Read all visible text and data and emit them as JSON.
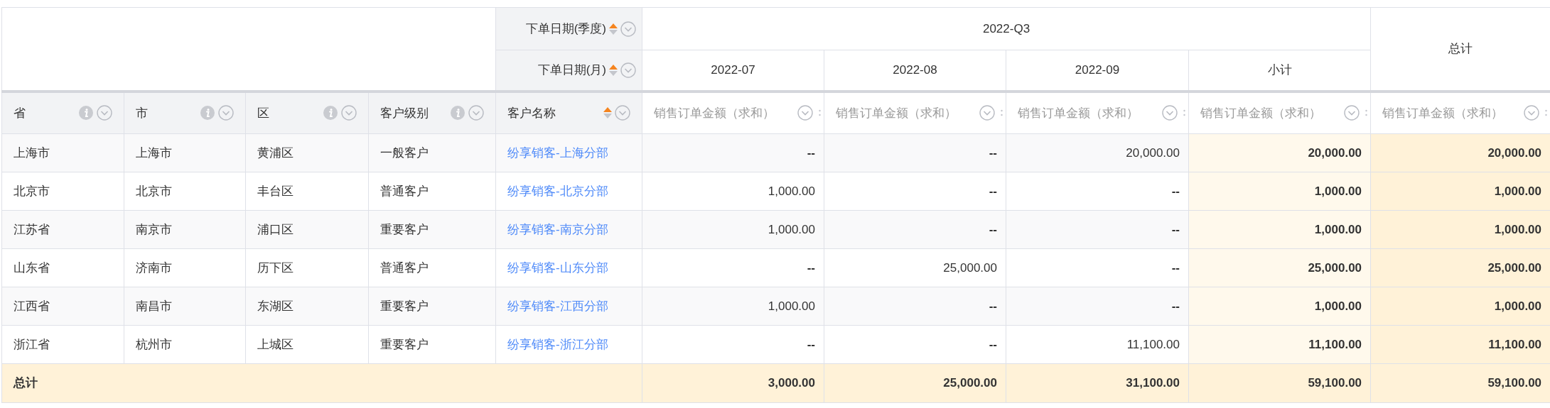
{
  "column_dimensions": [
    {
      "label": "下单日期(季度)",
      "ascending": true
    },
    {
      "label": "下单日期(月)",
      "ascending": true
    }
  ],
  "column_group": {
    "label": "2022-Q3",
    "columns": [
      "2022-07",
      "2022-08",
      "2022-09",
      "小计"
    ]
  },
  "grand_total_header": "总计",
  "row_fields": [
    {
      "label": "省",
      "kind": "info"
    },
    {
      "label": "市",
      "kind": "info"
    },
    {
      "label": "区",
      "kind": "info"
    },
    {
      "label": "客户级别",
      "kind": "info"
    },
    {
      "label": "客户名称",
      "kind": "sort",
      "ascending": true
    }
  ],
  "measure_headers": [
    "销售订单金额（求和）",
    "销售订单金额（求和）",
    "销售订单金额（求和）",
    "销售订单金额（求和）",
    "销售订单金额（求和）"
  ],
  "rows": [
    {
      "cells": [
        "上海市",
        "上海市",
        "黄浦区",
        "一般客户"
      ],
      "customer": "纷享销客-上海分部",
      "values": [
        "--",
        "--",
        "20,000.00"
      ],
      "subtotal": "20,000.00",
      "total": "20,000.00"
    },
    {
      "cells": [
        "北京市",
        "北京市",
        "丰台区",
        "普通客户"
      ],
      "customer": "纷享销客-北京分部",
      "values": [
        "1,000.00",
        "--",
        "--"
      ],
      "subtotal": "1,000.00",
      "total": "1,000.00"
    },
    {
      "cells": [
        "江苏省",
        "南京市",
        "浦口区",
        "重要客户"
      ],
      "customer": "纷享销客-南京分部",
      "values": [
        "1,000.00",
        "--",
        "--"
      ],
      "subtotal": "1,000.00",
      "total": "1,000.00"
    },
    {
      "cells": [
        "山东省",
        "济南市",
        "历下区",
        "普通客户"
      ],
      "customer": "纷享销客-山东分部",
      "values": [
        "--",
        "25,000.00",
        "--"
      ],
      "subtotal": "25,000.00",
      "total": "25,000.00"
    },
    {
      "cells": [
        "江西省",
        "南昌市",
        "东湖区",
        "重要客户"
      ],
      "customer": "纷享销客-江西分部",
      "values": [
        "1,000.00",
        "--",
        "--"
      ],
      "subtotal": "1,000.00",
      "total": "1,000.00"
    },
    {
      "cells": [
        "浙江省",
        "杭州市",
        "上城区",
        "重要客户"
      ],
      "customer": "纷享销客-浙江分部",
      "values": [
        "--",
        "--",
        "11,100.00"
      ],
      "subtotal": "11,100.00",
      "total": "11,100.00"
    }
  ],
  "total_row": {
    "label": "总计",
    "values": [
      "3,000.00",
      "25,000.00",
      "31,100.00"
    ],
    "subtotal": "59,100.00",
    "total": "59,100.00"
  }
}
